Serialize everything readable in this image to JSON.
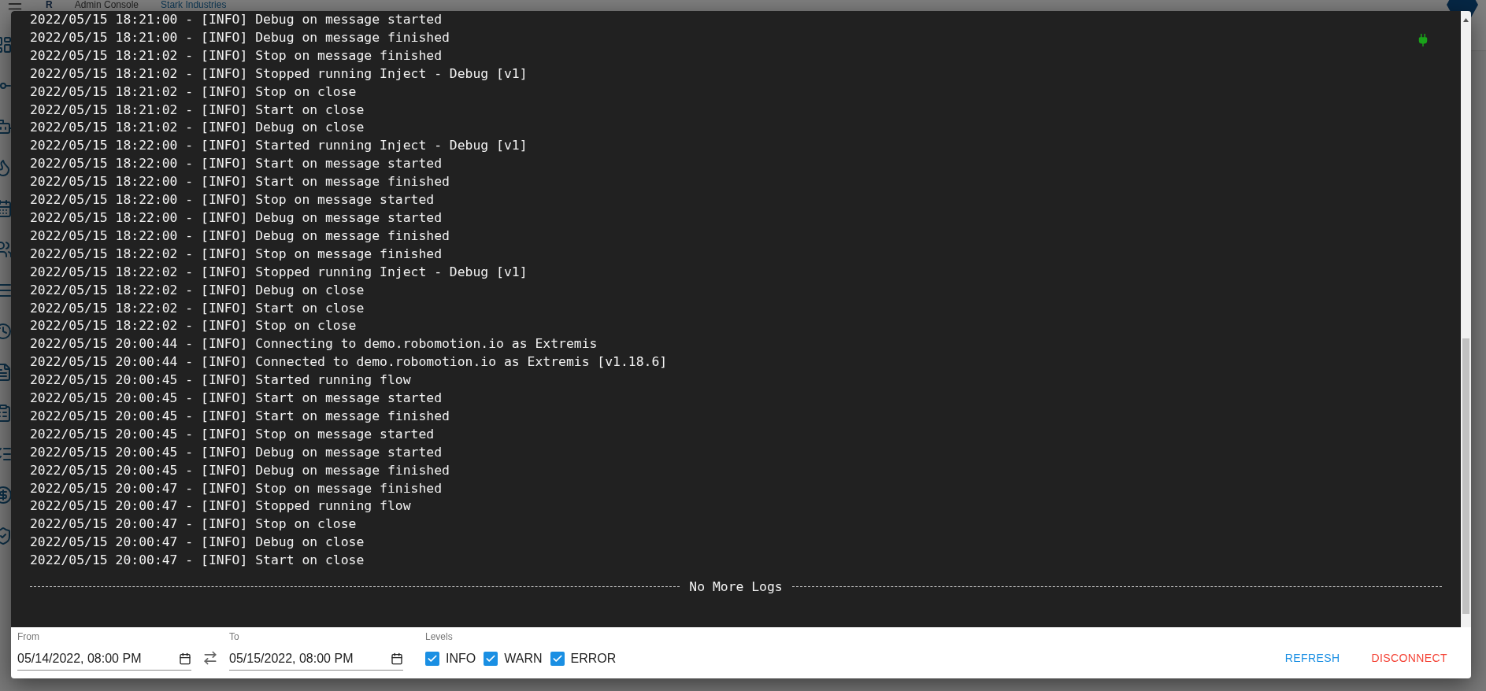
{
  "app_header": {
    "logo": "R",
    "title": "Admin Console",
    "workspace": "Stark Industries"
  },
  "log_viewer": {
    "lines": [
      "2022/05/15 18:21:00 - [INFO] Debug on message started",
      "2022/05/15 18:21:00 - [INFO] Debug on message finished",
      "2022/05/15 18:21:02 - [INFO] Stop on message finished",
      "2022/05/15 18:21:02 - [INFO] Stopped running Inject - Debug [v1]",
      "2022/05/15 18:21:02 - [INFO] Stop on close",
      "2022/05/15 18:21:02 - [INFO] Start on close",
      "2022/05/15 18:21:02 - [INFO] Debug on close",
      "2022/05/15 18:22:00 - [INFO] Started running Inject - Debug [v1]",
      "2022/05/15 18:22:00 - [INFO] Start on message started",
      "2022/05/15 18:22:00 - [INFO] Start on message finished",
      "2022/05/15 18:22:00 - [INFO] Stop on message started",
      "2022/05/15 18:22:00 - [INFO] Debug on message started",
      "2022/05/15 18:22:00 - [INFO] Debug on message finished",
      "2022/05/15 18:22:02 - [INFO] Stop on message finished",
      "2022/05/15 18:22:02 - [INFO] Stopped running Inject - Debug [v1]",
      "2022/05/15 18:22:02 - [INFO] Debug on close",
      "2022/05/15 18:22:02 - [INFO] Start on close",
      "2022/05/15 18:22:02 - [INFO] Stop on close",
      "2022/05/15 20:00:44 - [INFO] Connecting to demo.robomotion.io as Extremis",
      "2022/05/15 20:00:44 - [INFO] Connected to demo.robomotion.io as Extremis [v1.18.6]",
      "2022/05/15 20:00:45 - [INFO] Started running flow",
      "2022/05/15 20:00:45 - [INFO] Start on message started",
      "2022/05/15 20:00:45 - [INFO] Start on message finished",
      "2022/05/15 20:00:45 - [INFO] Stop on message started",
      "2022/05/15 20:00:45 - [INFO] Debug on message started",
      "2022/05/15 20:00:45 - [INFO] Debug on message finished",
      "2022/05/15 20:00:47 - [INFO] Stop on message finished",
      "2022/05/15 20:00:47 - [INFO] Stopped running flow",
      "2022/05/15 20:00:47 - [INFO] Stop on close",
      "2022/05/15 20:00:47 - [INFO] Debug on close",
      "2022/05/15 20:00:47 - [INFO] Start on close"
    ],
    "end_marker": "No More Logs",
    "connected": true
  },
  "filters": {
    "from": {
      "label": "From",
      "value": "05/14/2022, 08:00 PM"
    },
    "to": {
      "label": "To",
      "value": "05/15/2022, 08:00 PM"
    },
    "levels_label": "Levels",
    "levels": [
      {
        "label": "INFO",
        "checked": true
      },
      {
        "label": "WARN",
        "checked": true
      },
      {
        "label": "ERROR",
        "checked": true
      }
    ]
  },
  "actions": [
    {
      "label": "REFRESH",
      "kind": "primary"
    },
    {
      "label": "DISCONNECT",
      "kind": "danger"
    }
  ]
}
